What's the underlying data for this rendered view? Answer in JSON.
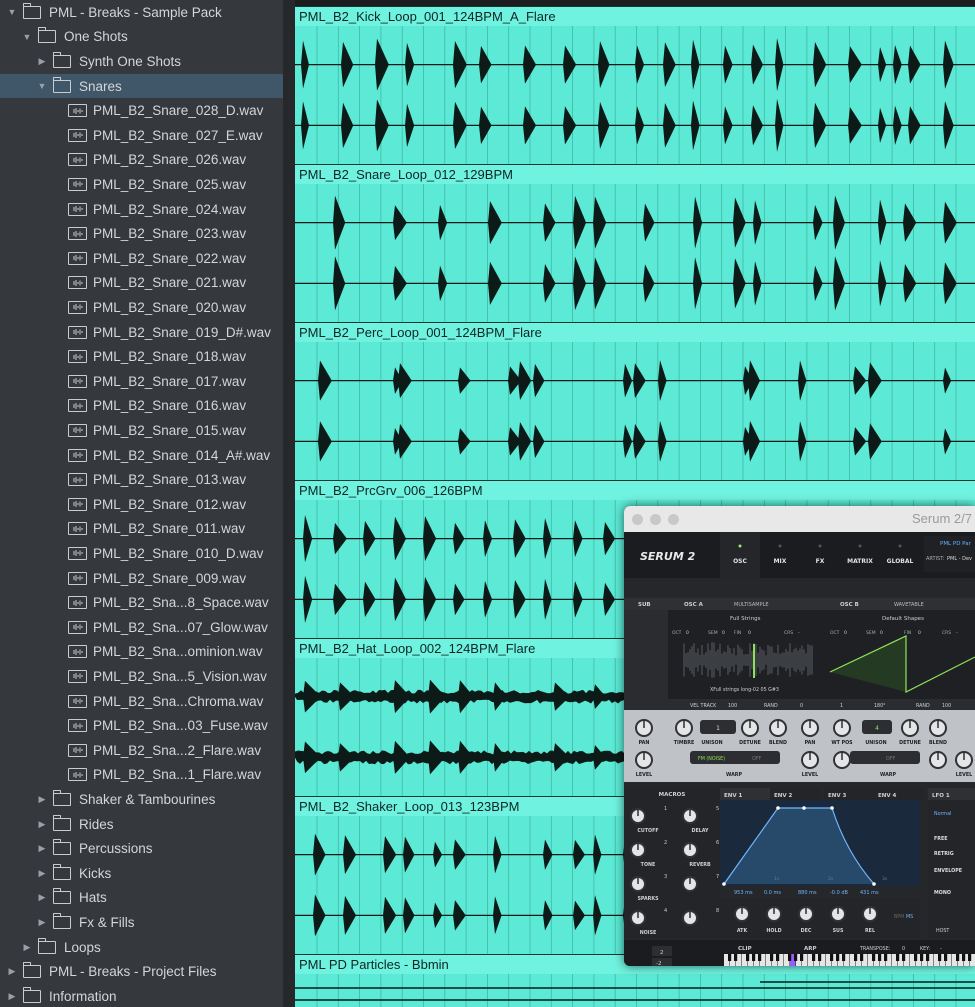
{
  "browser": {
    "items": [
      {
        "label": "PML - Breaks - Sample Pack",
        "type": "folder",
        "indent": 0,
        "expanded": true
      },
      {
        "label": "One Shots",
        "type": "folder",
        "indent": 1,
        "expanded": true
      },
      {
        "label": "Synth One Shots",
        "type": "folder",
        "indent": 2,
        "expanded": false
      },
      {
        "label": "Snares",
        "type": "folder",
        "indent": 2,
        "expanded": true,
        "selected": true
      },
      {
        "label": "PML_B2_Snare_028_D.wav",
        "type": "file",
        "indent": 3
      },
      {
        "label": "PML_B2_Snare_027_E.wav",
        "type": "file",
        "indent": 3
      },
      {
        "label": "PML_B2_Snare_026.wav",
        "type": "file",
        "indent": 3
      },
      {
        "label": "PML_B2_Snare_025.wav",
        "type": "file",
        "indent": 3
      },
      {
        "label": "PML_B2_Snare_024.wav",
        "type": "file",
        "indent": 3
      },
      {
        "label": "PML_B2_Snare_023.wav",
        "type": "file",
        "indent": 3
      },
      {
        "label": "PML_B2_Snare_022.wav",
        "type": "file",
        "indent": 3
      },
      {
        "label": "PML_B2_Snare_021.wav",
        "type": "file",
        "indent": 3
      },
      {
        "label": "PML_B2_Snare_020.wav",
        "type": "file",
        "indent": 3
      },
      {
        "label": "PML_B2_Snare_019_D#.wav",
        "type": "file",
        "indent": 3
      },
      {
        "label": "PML_B2_Snare_018.wav",
        "type": "file",
        "indent": 3
      },
      {
        "label": "PML_B2_Snare_017.wav",
        "type": "file",
        "indent": 3
      },
      {
        "label": "PML_B2_Snare_016.wav",
        "type": "file",
        "indent": 3
      },
      {
        "label": "PML_B2_Snare_015.wav",
        "type": "file",
        "indent": 3
      },
      {
        "label": "PML_B2_Snare_014_A#.wav",
        "type": "file",
        "indent": 3
      },
      {
        "label": "PML_B2_Snare_013.wav",
        "type": "file",
        "indent": 3
      },
      {
        "label": "PML_B2_Snare_012.wav",
        "type": "file",
        "indent": 3
      },
      {
        "label": "PML_B2_Snare_011.wav",
        "type": "file",
        "indent": 3
      },
      {
        "label": "PML_B2_Snare_010_D.wav",
        "type": "file",
        "indent": 3
      },
      {
        "label": "PML_B2_Snare_009.wav",
        "type": "file",
        "indent": 3
      },
      {
        "label": "PML_B2_Sna...8_Space.wav",
        "type": "file",
        "indent": 3
      },
      {
        "label": "PML_B2_Sna...07_Glow.wav",
        "type": "file",
        "indent": 3
      },
      {
        "label": "PML_B2_Sna...ominion.wav",
        "type": "file",
        "indent": 3
      },
      {
        "label": "PML_B2_Sna...5_Vision.wav",
        "type": "file",
        "indent": 3
      },
      {
        "label": "PML_B2_Sna...Chroma.wav",
        "type": "file",
        "indent": 3
      },
      {
        "label": "PML_B2_Sna...03_Fuse.wav",
        "type": "file",
        "indent": 3
      },
      {
        "label": "PML_B2_Sna...2_Flare.wav",
        "type": "file",
        "indent": 3
      },
      {
        "label": "PML_B2_Sna...1_Flare.wav",
        "type": "file",
        "indent": 3
      },
      {
        "label": "Shaker & Tambourines",
        "type": "folder",
        "indent": 2,
        "expanded": false
      },
      {
        "label": "Rides",
        "type": "folder",
        "indent": 2,
        "expanded": false
      },
      {
        "label": "Percussions",
        "type": "folder",
        "indent": 2,
        "expanded": false
      },
      {
        "label": "Kicks",
        "type": "folder",
        "indent": 2,
        "expanded": false
      },
      {
        "label": "Hats",
        "type": "folder",
        "indent": 2,
        "expanded": false
      },
      {
        "label": "Fx & Fills",
        "type": "folder",
        "indent": 2,
        "expanded": false
      },
      {
        "label": "Loops",
        "type": "folder",
        "indent": 1,
        "expanded": false
      },
      {
        "label": "PML - Breaks - Project Files",
        "type": "folder",
        "indent": 0,
        "expanded": false
      },
      {
        "label": "Information",
        "type": "folder",
        "indent": 0,
        "expanded": false
      }
    ]
  },
  "tracks": [
    {
      "title": "PML_B2_Kick_Loop_001_124BPM_A_Flare"
    },
    {
      "title": "PML_B2_Snare_Loop_012_129BPM"
    },
    {
      "title": "PML_B2_Perc_Loop_001_124BPM_Flare"
    },
    {
      "title": "PML_B2_PrcGrv_006_126BPM"
    },
    {
      "title": "PML_B2_Hat_Loop_002_124BPM_Flare"
    },
    {
      "title": "PML_B2_Shaker_Loop_013_123BPM"
    },
    {
      "title": "PML PD Particles - Bbmin"
    }
  ],
  "serum": {
    "window_title": "Serum 2/7",
    "logo": "SERUM 2",
    "tabs": [
      "OSC",
      "MIX",
      "FX",
      "MATRIX",
      "GLOBAL"
    ],
    "preset_name": "PML PD Par",
    "artist_label": "ARTIST:",
    "artist": "PML - Dev",
    "sub_label": "SUB",
    "osc_a": {
      "label": "OSC A",
      "mode": "MULTISAMPLE",
      "sample": "Full Strings",
      "file": "XFull strings long-02 05 G#3",
      "oct": "OCT",
      "oct_val": "0",
      "sem": "SEM",
      "sem_val": "0",
      "fin": "FIN",
      "fin_val": "0",
      "crs": "CRS",
      "crs_val": "-",
      "vel_track": "VEL TRACK",
      "vel_val": "100",
      "rand": "RAND",
      "rand_val": "0",
      "unison_val": "1",
      "warp_mode": "FM (NOISE)",
      "warp_off": "OFF"
    },
    "osc_b": {
      "label": "OSC B",
      "mode": "WAVETABLE",
      "table": "Default Shapes",
      "oct": "OCT",
      "oct_val": "0",
      "sem": "SEM",
      "sem_val": "0",
      "fin": "FIN",
      "fin_val": "0",
      "crs": "CRS",
      "crs_val": "-",
      "phase": "180°",
      "rand": "RAND",
      "rand_val": "100",
      "unison_val": "4",
      "warp_off": "OFF",
      "wt_val": "1"
    },
    "knobs_a": [
      "PAN",
      "TIMBRE",
      "UNISON",
      "DETUNE",
      "BLEND",
      "PAN",
      "LEVEL",
      "WARP",
      "LEVEL"
    ],
    "knobs_b": [
      "WT POS",
      "UNISON",
      "DETUNE",
      "BLEND",
      "WARP",
      "LEVEL"
    ],
    "macros_title": "MACROS",
    "macros": [
      {
        "name": "CUTOFF",
        "n": "1"
      },
      {
        "name": "DELAY",
        "n": "5"
      },
      {
        "name": "TONE",
        "n": "2"
      },
      {
        "name": "REVERB",
        "n": "6"
      },
      {
        "name": "SPARKS",
        "n": "3"
      },
      {
        "name": "",
        "n": "7"
      },
      {
        "name": "NOISE",
        "n": "4"
      },
      {
        "name": "",
        "n": "8"
      }
    ],
    "env_tabs": [
      "ENV 1",
      "ENV 2",
      "ENV 3",
      "ENV 4"
    ],
    "lfo_tab": "LFO 1",
    "env_values": [
      "953 ms",
      "0.0 ms",
      "880 ms",
      "-0.0 dB",
      "431 ms"
    ],
    "env_knobs": [
      "ATK",
      "HOLD",
      "DEC",
      "SUS",
      "REL"
    ],
    "bpm": "BPM",
    "ms": "MS",
    "lfo_modes": [
      "Normal",
      "FREE",
      "RETRIG",
      "ENVELOPE",
      "MONO"
    ],
    "host": "HOST",
    "clip": "CLIP",
    "arp": "ARP",
    "transpose_label": "TRANSPOSE:",
    "transpose_val": "0",
    "key_label": "KEY:",
    "key_val": "-",
    "octave_up": "2",
    "octave_down": "-2",
    "env_grid": [
      "1s",
      "2s",
      "3s"
    ]
  }
}
